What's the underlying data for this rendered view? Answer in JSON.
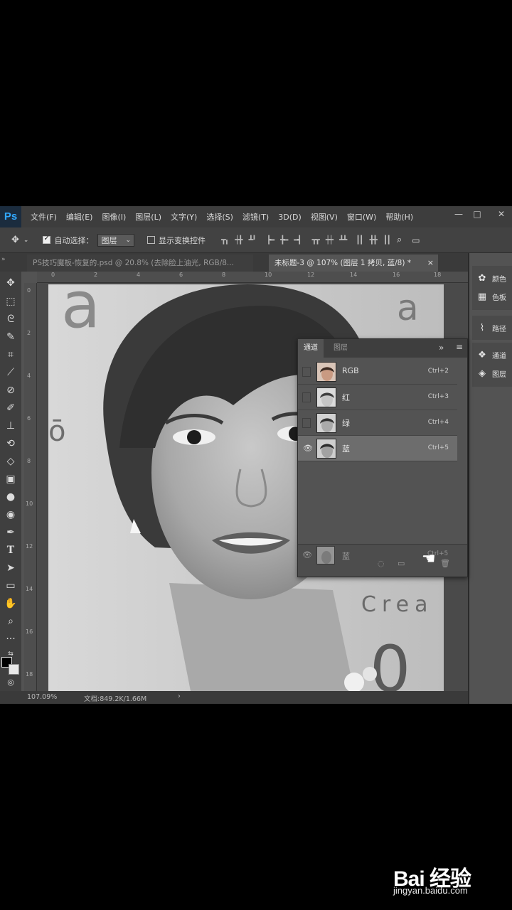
{
  "app": {
    "logo": "Ps"
  },
  "menu": [
    "文件(F)",
    "编辑(E)",
    "图像(I)",
    "图层(L)",
    "文字(Y)",
    "选择(S)",
    "滤镜(T)",
    "3D(D)",
    "视图(V)",
    "窗口(W)",
    "帮助(H)"
  ],
  "window_controls": {
    "minimize": "—",
    "maximize": "□",
    "close": "✕"
  },
  "options": {
    "auto_select_label": "自动选择：",
    "auto_select_checked": true,
    "auto_select_value": "图层",
    "show_transform_label": "显示变换控件",
    "show_transform_checked": false
  },
  "tabs": [
    {
      "label": "PS技巧魔板-恢复的.psd @ 20.8% (去除脸上油光, RGB/8...",
      "active": false
    },
    {
      "label": "未标题-3 @ 107% (图层 1 拷贝, 蓝/8) *",
      "active": true,
      "close": "×"
    }
  ],
  "ruler_top_ticks": [
    "0",
    "2",
    "4",
    "6",
    "8",
    "10",
    "12",
    "14",
    "16",
    "18"
  ],
  "ruler_left_ticks": [
    "0",
    "2",
    "4",
    "6",
    "8",
    "10",
    "12",
    "14",
    "16",
    "18"
  ],
  "status": {
    "zoom": "107.09%",
    "doc_info": "文档:849.2K/1.66M",
    "arrow": "›"
  },
  "right_dock": {
    "group1": [
      {
        "icon": "palette-icon",
        "glyph": "✿",
        "label": "颜色"
      },
      {
        "icon": "swatches-icon",
        "glyph": "▦",
        "label": "色板"
      }
    ],
    "group2": [
      {
        "icon": "paths-icon",
        "glyph": "⌇",
        "label": "路径"
      }
    ],
    "group3": [
      {
        "icon": "channels-icon",
        "glyph": "❖",
        "label": "通道"
      },
      {
        "icon": "layers-icon",
        "glyph": "◈",
        "label": "图层"
      }
    ]
  },
  "channels_panel": {
    "tabs": [
      "通道",
      "图层"
    ],
    "collapse_glyph": "»",
    "menu_glyph": "≡",
    "channels": [
      {
        "name": "RGB",
        "shortcut": "Ctrl+2",
        "visible": false,
        "selected": false,
        "color": "true"
      },
      {
        "name": "红",
        "shortcut": "Ctrl+3",
        "visible": false,
        "selected": false
      },
      {
        "name": "绿",
        "shortcut": "Ctrl+4",
        "visible": false,
        "selected": false
      },
      {
        "name": "蓝",
        "shortcut": "Ctrl+5",
        "visible": true,
        "selected": true
      }
    ],
    "dragging": {
      "name": "蓝",
      "shortcut": "Ctrl+5"
    }
  },
  "canvas_text": {
    "sign_word": "Crea"
  },
  "watermark": {
    "brand": "Bai 经验",
    "url": "jingyan.baidu.com"
  },
  "colors": {
    "ui_dark": "#3d3d3d",
    "ui_mid": "#535353",
    "selection": "#6d6d6d"
  }
}
